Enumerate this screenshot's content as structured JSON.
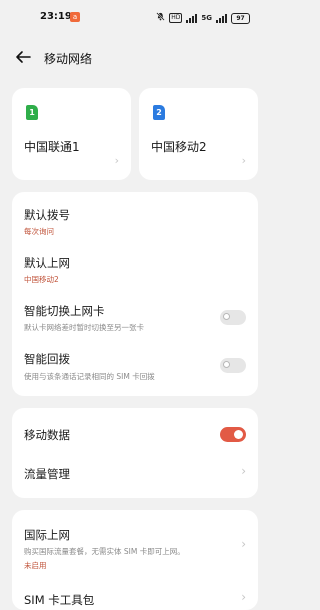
{
  "status_bar": {
    "time": "23:19",
    "notification": "a",
    "network": "HD",
    "signal": "5G",
    "battery": "97"
  },
  "header": {
    "title": "移动网络"
  },
  "sims": [
    {
      "slot": "1",
      "name": "中国联通1",
      "color": "#2fae4a"
    },
    {
      "slot": "2",
      "name": "中国移动2",
      "color": "#2b7be0"
    }
  ],
  "calls_section": {
    "default_dial": {
      "label": "默认拨号",
      "value": "每次询问"
    },
    "default_data": {
      "label": "默认上网",
      "value": "中国移动2"
    },
    "smart_switch": {
      "label": "智能切换上网卡",
      "desc": "默认卡网络差时暂时切换至另一张卡",
      "enabled": false
    },
    "smart_callback": {
      "label": "智能回拨",
      "desc": "使用与该条通话记录相同的 SIM 卡回拨",
      "enabled": false
    }
  },
  "data_section": {
    "mobile_data": {
      "label": "移动数据",
      "enabled": true
    },
    "data_usage": {
      "label": "流量管理"
    }
  },
  "intl_section": {
    "roaming": {
      "label": "国际上网",
      "desc": "购买国际流量套餐，无需实体 SIM 卡即可上网。",
      "status": "未启用"
    },
    "sim_toolkit": {
      "label": "SIM 卡工具包"
    }
  }
}
